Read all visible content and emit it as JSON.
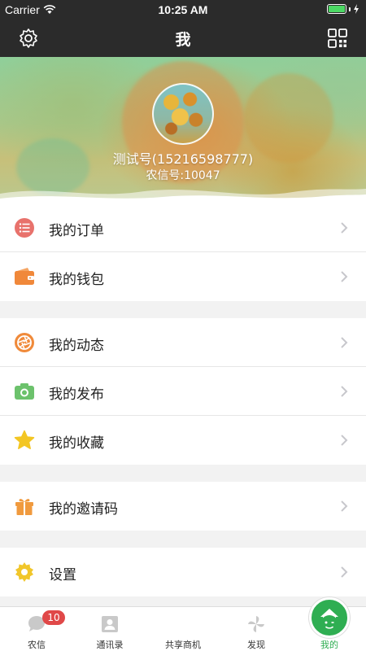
{
  "status_bar": {
    "carrier": "Carrier",
    "time": "10:25 AM",
    "battery_level": 1.0
  },
  "nav": {
    "title": "我",
    "left_icon": "settings-gear-icon",
    "right_icon": "qr-code-icon"
  },
  "profile": {
    "name": "测试号(15216598777)",
    "id_label": "农信号:10047",
    "avatar": "avatar-sunflowers"
  },
  "menu_groups": [
    [
      {
        "label": "我的订单",
        "icon": "order-list-icon",
        "color": "#e8726c"
      },
      {
        "label": "我的钱包",
        "icon": "wallet-icon",
        "color": "#f0883a"
      }
    ],
    [
      {
        "label": "我的动态",
        "icon": "aperture-icon",
        "color": "#f08a3a"
      },
      {
        "label": "我的发布",
        "icon": "camera-icon",
        "color": "#6cc26c"
      },
      {
        "label": "我的收藏",
        "icon": "star-icon",
        "color": "#f3c623"
      }
    ],
    [
      {
        "label": "我的邀请码",
        "icon": "gift-icon",
        "color": "#f09a3e"
      }
    ],
    [
      {
        "label": "设置",
        "icon": "gear-icon",
        "color": "#f1c62a"
      }
    ]
  ],
  "tabs": [
    {
      "label": "农信",
      "icon": "chat-bubble-icon",
      "badge": "10"
    },
    {
      "label": "通讯录",
      "icon": "contacts-icon"
    },
    {
      "label": "共享商机",
      "icon": "home-icon"
    },
    {
      "label": "发现",
      "icon": "pinwheel-icon"
    },
    {
      "label": "我的",
      "icon": "smiley-icon",
      "active": true
    }
  ],
  "colors": {
    "accent": "#2fae52",
    "nav_bg": "#2b2b2b",
    "badge": "#e04848"
  }
}
